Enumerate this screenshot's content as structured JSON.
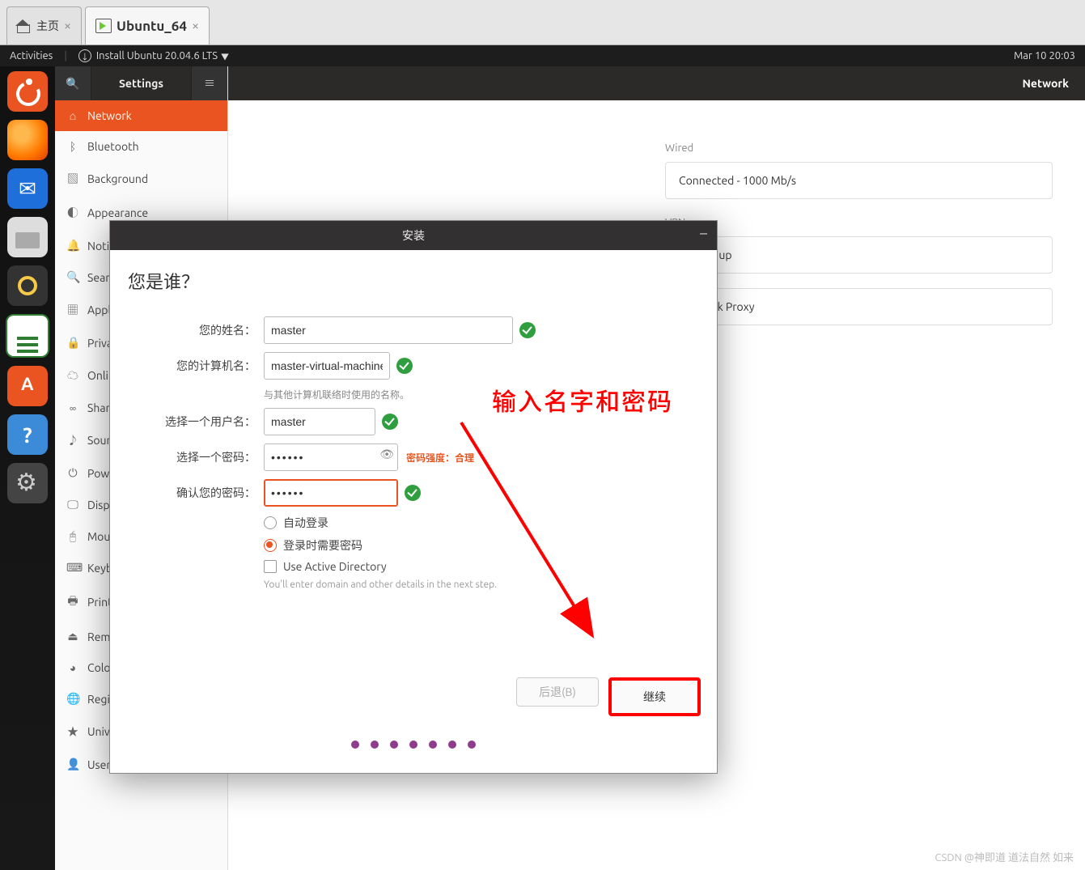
{
  "vm_tabs": {
    "home": "主页",
    "active": "Ubuntu_64"
  },
  "topbar": {
    "activities": "Activities",
    "app": "Install Ubuntu 20.04.6 LTS",
    "clock": "Mar 10  20:03"
  },
  "settings": {
    "title": "Settings",
    "content_title": "Network",
    "items": [
      "Network",
      "Bluetooth",
      "Background",
      "Appearance",
      "Notifications",
      "Search",
      "Applications",
      "Privacy",
      "Online Accounts",
      "Sharing",
      "Sound",
      "Power",
      "Displays",
      "Mouse & Touchpad",
      "Keyboard Shortcuts",
      "Printers",
      "Removable Media",
      "Color",
      "Region & Language",
      "Universal Access",
      "Users"
    ],
    "icons": [
      "⌂",
      "ᛒ",
      "▧",
      "◐",
      "🔔",
      "🔍",
      "▦",
      "🔒",
      "☁",
      "∞",
      "♪",
      "⏻",
      "🖵",
      "🖰",
      "⌨",
      "🖶",
      "⏏",
      "◕",
      "🌐",
      "★",
      "👤"
    ]
  },
  "network": {
    "wired_lbl": "Wired",
    "wired_status": "Connected - 1000 Mb/s",
    "vpn_lbl": "VPN",
    "vpn_status": "Not set up",
    "proxy_lbl": "Network Proxy"
  },
  "installer": {
    "title": "安装",
    "heading": "您是谁？",
    "name_lbl": "您的姓名：",
    "name_val": "master",
    "host_lbl": "您的计算机名：",
    "host_val": "master-virtual-machine",
    "host_hint": "与其他计算机联络时使用的名称。",
    "user_lbl": "选择一个用户名：",
    "user_val": "master",
    "pw_lbl": "选择一个密码：",
    "pw_val": "••••••",
    "strength": "密码强度：合理",
    "pw2_lbl": "确认您的密码：",
    "pw2_val": "••••••",
    "auto_login": "自动登录",
    "require_pw": "登录时需要密码",
    "ad_label": "Use Active Directory",
    "ad_hint": "You'll enter domain and other details in the next step.",
    "back_btn": "后退(B)",
    "continue_btn": "继续"
  },
  "annotation": "输入名字和密码",
  "watermark": "CSDN @神即道 道法自然 如来"
}
